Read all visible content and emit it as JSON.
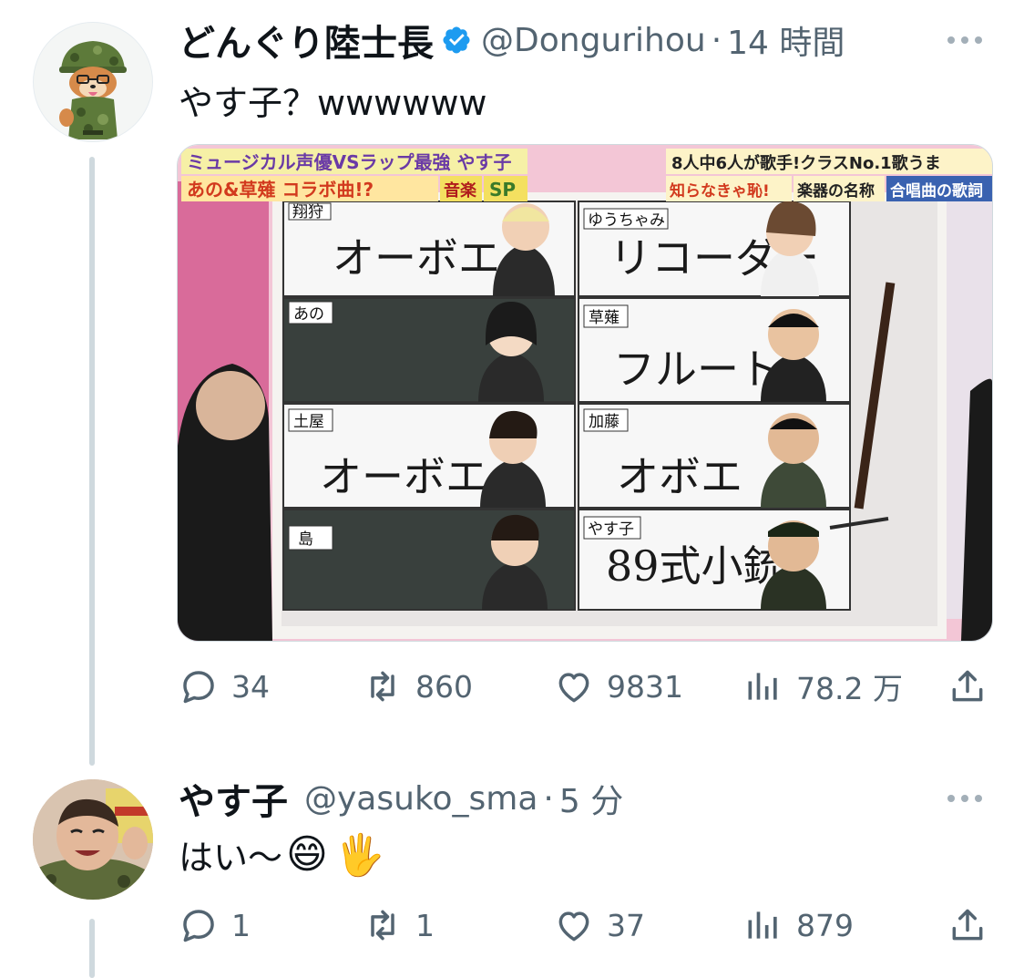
{
  "tweet1": {
    "display_name": "どんぐり陸士長",
    "handle": "@Dongurihou",
    "separator": "·",
    "time": "14 時間",
    "text": "やす子？wwwwww",
    "verified": true,
    "media": {
      "banner_left_1": "ミュージカル声優VSラップ最強 やす子",
      "banner_left_2": "あの&草薙 コラボ曲!?",
      "banner_badge_1": "音楽",
      "banner_badge_2": "SP",
      "banner_right_1": "8人中6人が歌手!クラスNo.1歌うま",
      "banner_right_2a": "知らなきゃ恥!",
      "banner_right_2b": "楽器の名称",
      "banner_right_2c": "合唱曲の歌詞",
      "board": [
        {
          "label": "翔狩",
          "answer": "オーボエ"
        },
        {
          "label": "ゆうちゃみ",
          "answer": "リコーダー"
        },
        {
          "label": "あの",
          "answer": ""
        },
        {
          "label": "草薙",
          "answer": "フルート"
        },
        {
          "label": "土屋",
          "answer": "オーボエ"
        },
        {
          "label": "加藤",
          "answer": "オボエ"
        },
        {
          "label": "島",
          "answer": ""
        },
        {
          "label": "やす子",
          "answer": "89式小銃"
        }
      ]
    },
    "actions": {
      "reply": "34",
      "retweet": "860",
      "like": "9831",
      "views": "78.2 万"
    }
  },
  "tweet2": {
    "display_name": "やす子",
    "handle": "@yasuko_sma",
    "separator": "·",
    "time": "5 分",
    "text": "はい〜",
    "emoji_1": "😄",
    "emoji_2": "🖐",
    "actions": {
      "reply": "1",
      "retweet": "1",
      "like": "37",
      "views": "879"
    }
  },
  "colors": {
    "text": "#0f1419",
    "secondary": "#536471",
    "verified": "#1d9bf0",
    "thread_line": "#cfd9de"
  },
  "icons": [
    "verified-badge-icon",
    "more-icon",
    "reply-icon",
    "retweet-icon",
    "like-icon",
    "views-icon",
    "share-icon"
  ]
}
